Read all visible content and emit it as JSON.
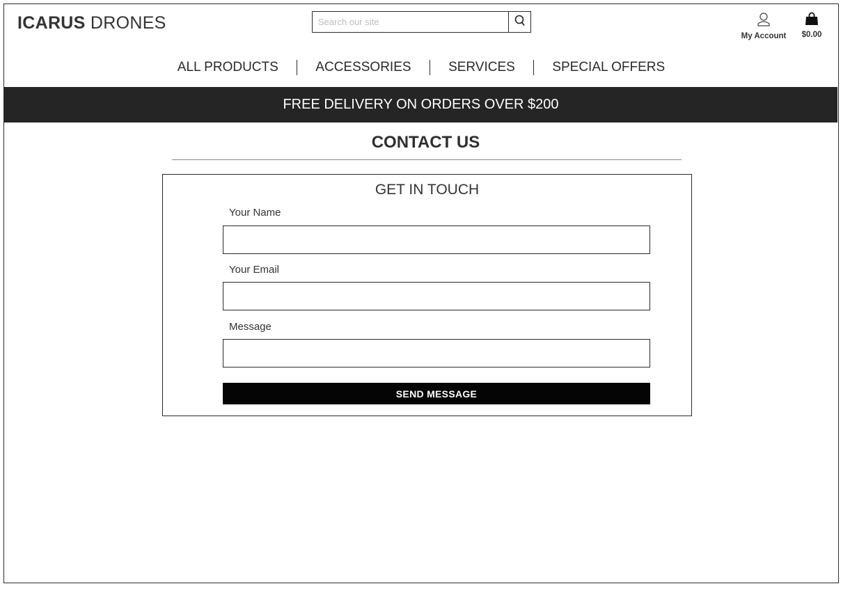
{
  "header": {
    "logo_brand": "ICARUS",
    "logo_rest": "DRONES",
    "search_placeholder": "Search our site",
    "search_icon": "search-icon",
    "account_icon": "user-icon",
    "account_label": "My Account",
    "cart_icon": "shopping-bag-icon",
    "cart_total": "$0.00"
  },
  "nav": {
    "items": [
      {
        "label": "ALL PRODUCTS"
      },
      {
        "label": "ACCESSORIES"
      },
      {
        "label": "SERVICES"
      },
      {
        "label": "SPECIAL OFFERS"
      }
    ]
  },
  "banner": {
    "text": "FREE DELIVERY ON ORDERS OVER $200",
    "background": "#252525"
  },
  "page": {
    "title": "CONTACT US"
  },
  "form": {
    "heading": "GET IN TOUCH",
    "name_label": "Your Name",
    "name_value": "",
    "email_label": "Your Email",
    "email_value": "",
    "message_label": "Message",
    "message_value": "",
    "submit_label": "SEND MESSAGE"
  }
}
